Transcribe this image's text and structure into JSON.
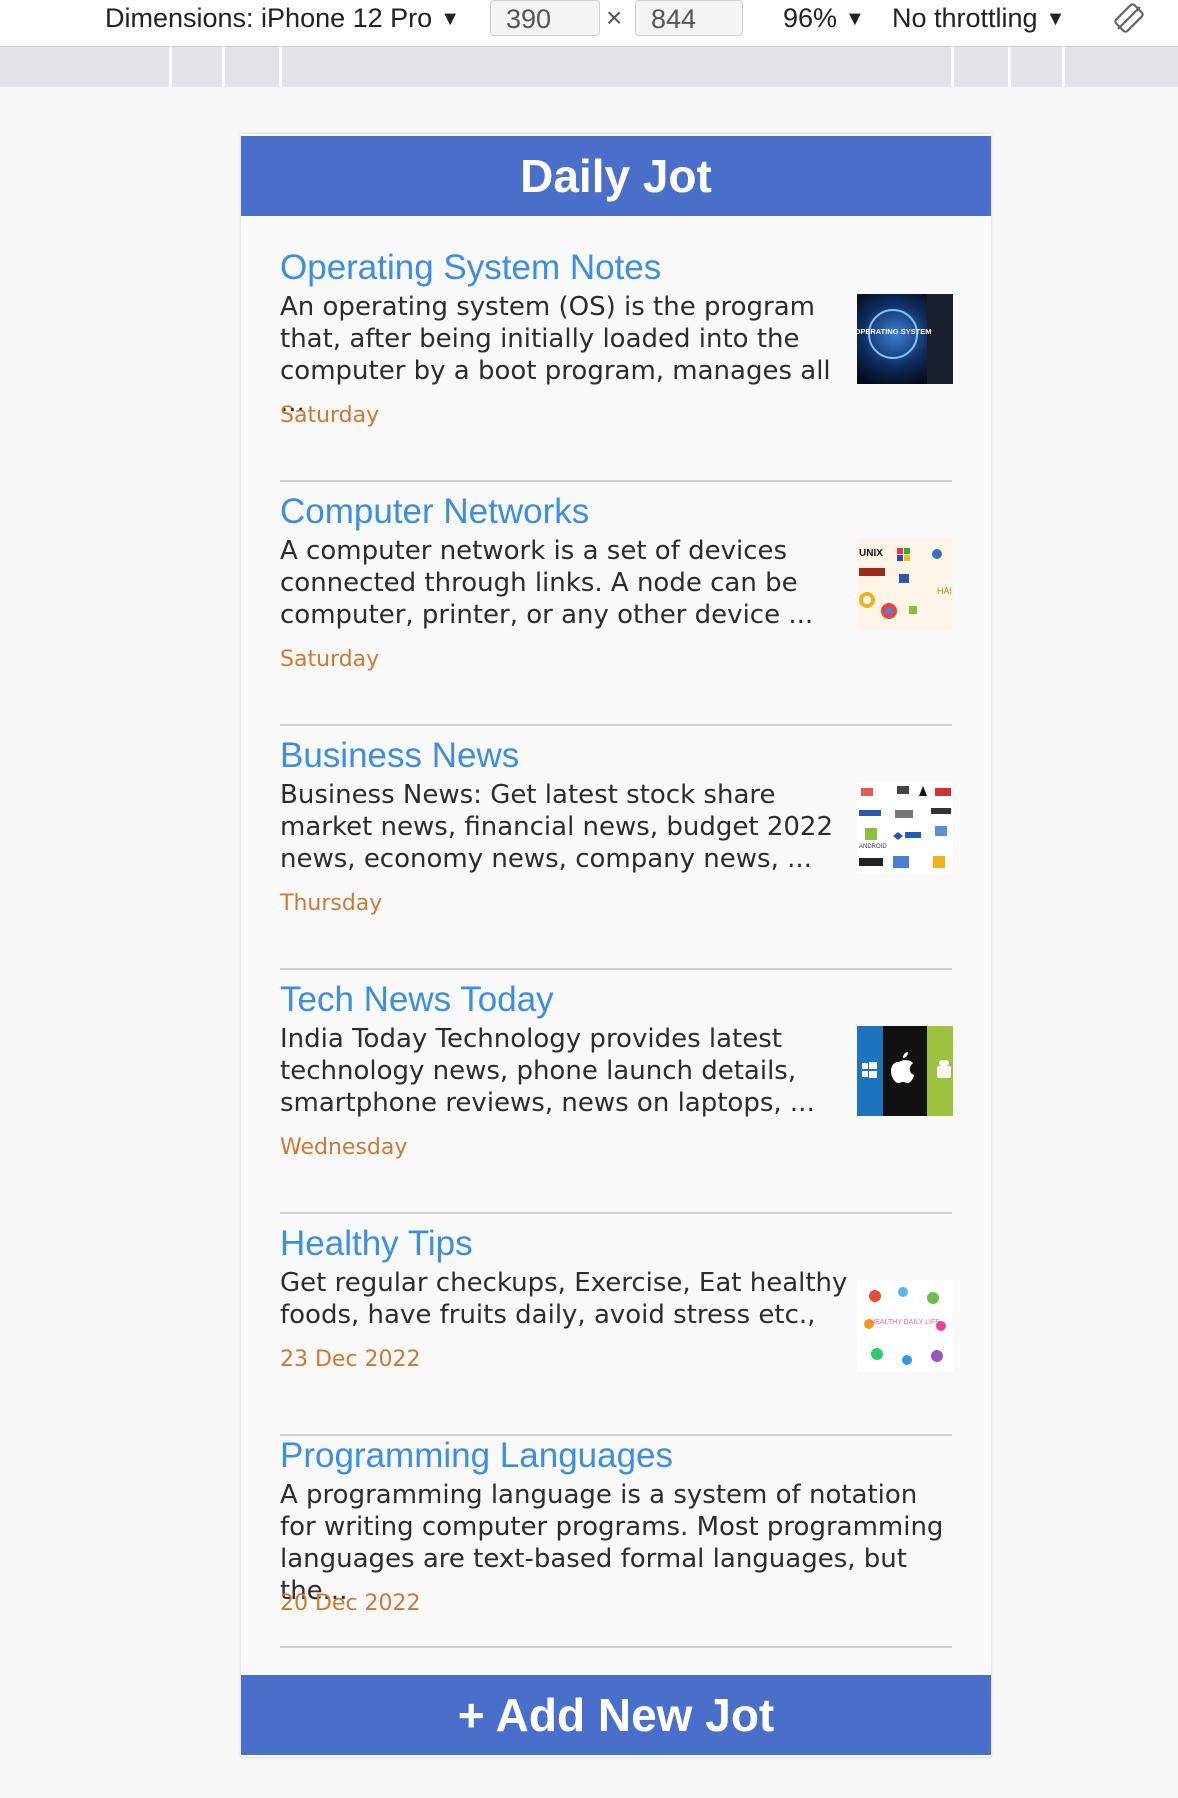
{
  "devtools": {
    "device_label": "Dimensions: iPhone 12 Pro",
    "width_value": "390",
    "times_sign": "×",
    "height_value": "844",
    "zoom": "96%",
    "throttling": "No throttling",
    "caret": "▼"
  },
  "app": {
    "title": "Daily Jot",
    "add_button": "+ Add New Jot"
  },
  "notes": [
    {
      "title": "Operating System Notes",
      "body": "An operating system (OS) is the program that, after being initially loaded into the computer by a boot program, manages all ...",
      "date": "Saturday",
      "thumb_text": "OPERATING SYSTEM"
    },
    {
      "title": "Computer Networks",
      "body": "A computer network is a set of devices connected through links. A node can be computer, printer, or any other device ...",
      "date": "Saturday",
      "thumb_text": "UNIX"
    },
    {
      "title": "Business News",
      "body": "Business News: Get latest stock share market news, financial news, budget 2022 news, economy news, company news, ...",
      "date": "Thursday",
      "thumb_text": "ANDROID"
    },
    {
      "title": "Tech News Today",
      "body": "India Today Technology provides latest technology news, phone launch details, smartphone reviews, news on laptops, ...",
      "date": "Wednesday",
      "thumb_text": ""
    },
    {
      "title": "Healthy Tips",
      "body": "Get regular checkups, Exercise, Eat healthy foods, have fruits daily, avoid stress etc.,",
      "date": "23 Dec 2022",
      "thumb_text": "HEALTHY DAILY LIFE"
    },
    {
      "title": "Programming Languages",
      "body": "A programming language is a system of notation for writing computer programs. Most programming languages are text-based formal languages, but the...",
      "date": "20 Dec 2022",
      "thumb_text": ""
    }
  ],
  "colors": {
    "header_bg": "#4a6fcb",
    "title_link": "#3b8ee0",
    "date_text": "#cc7a33"
  }
}
